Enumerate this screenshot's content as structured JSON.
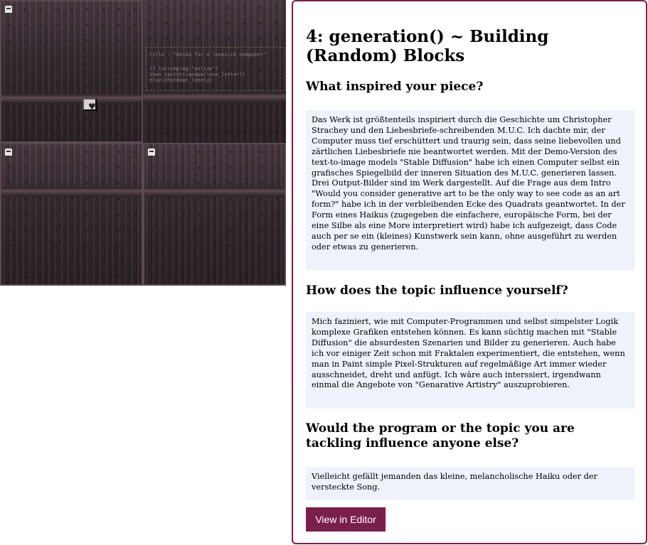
{
  "artwork": {
    "tiles": [
      "tile-1",
      "tile-2",
      "tile-3",
      "tile-4"
    ],
    "code_lines": [
      "title : \"Haiku for a lovesick computer\"",
      "if (strcmp(mg:\"online\")",
      "then (print(random(love_letter))",
      "else(shutdown_lohely)"
    ],
    "heart_symbol": "♥"
  },
  "panel": {
    "title": "4: generation() ~ Building (Random) Blocks",
    "sections": [
      {
        "question": "What inspired your piece?",
        "answer": "Das Werk ist größtenteils inspiriert durch die Geschichte um Christopher Strachey und den Liebesbriefe-schreibenden M.U.C. Ich dachte mir, der Computer muss tief erschüttert und traurig sein, dass seine liebevollen und zärtlichen Liebesbriefe nie beantwortet werden. Mit der Demo-Version des text-to-image models \"Stable Diffusion\" habe ich einen Computer selbst ein grafisches Spiegelbild der inneren Situation des M.U.C. generieren lassen. Drei Output-Bilder sind im Werk dargestellt. Auf die Frage aus dem Intro \"Would you consider generative art to be the only way to see code as an art form?\" habe ich in der verbleibenden Ecke des Quadrats geantwortet. In der Form eines Haikus (zugegeben die einfachere, europäische Form, bei der eine Silbe als eine More interpretiert wird) habe ich aufgezeigt, dass Code auch per se ein (kleines) Kunstwerk sein kann, ohne ausgeführt zu werden oder etwas zu generieren."
      },
      {
        "question": "How does the topic influence yourself?",
        "answer": "Mich faziniert, wie mit Computer-Programmen und selbst simpelster Logik komplexe Grafiken entstehen können. Es kann süchtig machen mit \"Stable Diffusion\" die absurdesten Szenarien und Bilder zu generieren. Auch habe ich vor einiger Zeit schon mit Fraktalen experimentiert, die entstehen, wenn man in Paint simple Pixel-Strukturen auf regelmäßige Art immer wieder ausschneidet, dreht und anfügt. Ich wäre auch interssiert, irgendwann einmal die Angebote von \"Genarative Artistry\" auszuprobieren."
      },
      {
        "question": "Would the program or the topic you are tackling influence anyone else?",
        "answer": "Vielleicht gefällt jemanden das kleine, melancholische Haiku oder der versteckte Song."
      }
    ],
    "editor_button": "View in Editor"
  },
  "colors": {
    "accent": "#7a1f4b",
    "answer_bg": "#eef2fb",
    "art_base": "#3e3038"
  }
}
